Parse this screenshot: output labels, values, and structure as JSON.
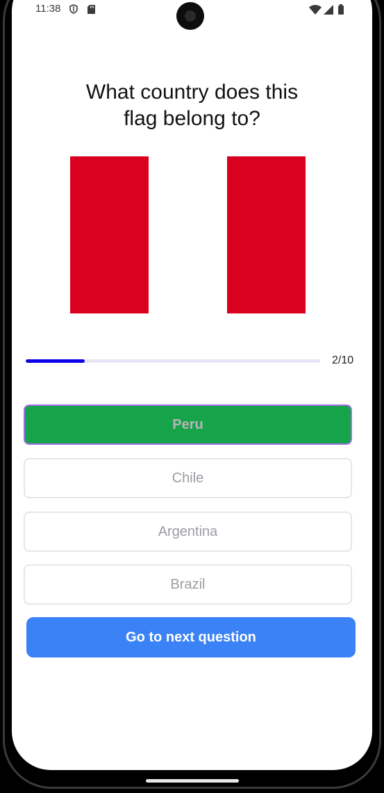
{
  "status_bar": {
    "time": "11:38",
    "icons": [
      "shield-icon",
      "sd-card-icon",
      "wifi-icon",
      "signal-icon",
      "battery-icon"
    ]
  },
  "quiz": {
    "question_line1": "What country does this",
    "question_line2": "flag belong to?",
    "flag": {
      "stripes": [
        "#d90020",
        "#ffffff",
        "#d90020"
      ]
    },
    "progress": {
      "current": 2,
      "total": 10,
      "label": "2/10"
    },
    "options": [
      {
        "label": "Peru",
        "state": "correct"
      },
      {
        "label": "Chile",
        "state": "disabled"
      },
      {
        "label": "Argentina",
        "state": "disabled"
      },
      {
        "label": "Brazil",
        "state": "disabled"
      }
    ],
    "next_button_label": "Go to next question"
  },
  "colors": {
    "correct": "#16a34a",
    "primary": "#3b82f6",
    "progress": "#0b00e6"
  }
}
